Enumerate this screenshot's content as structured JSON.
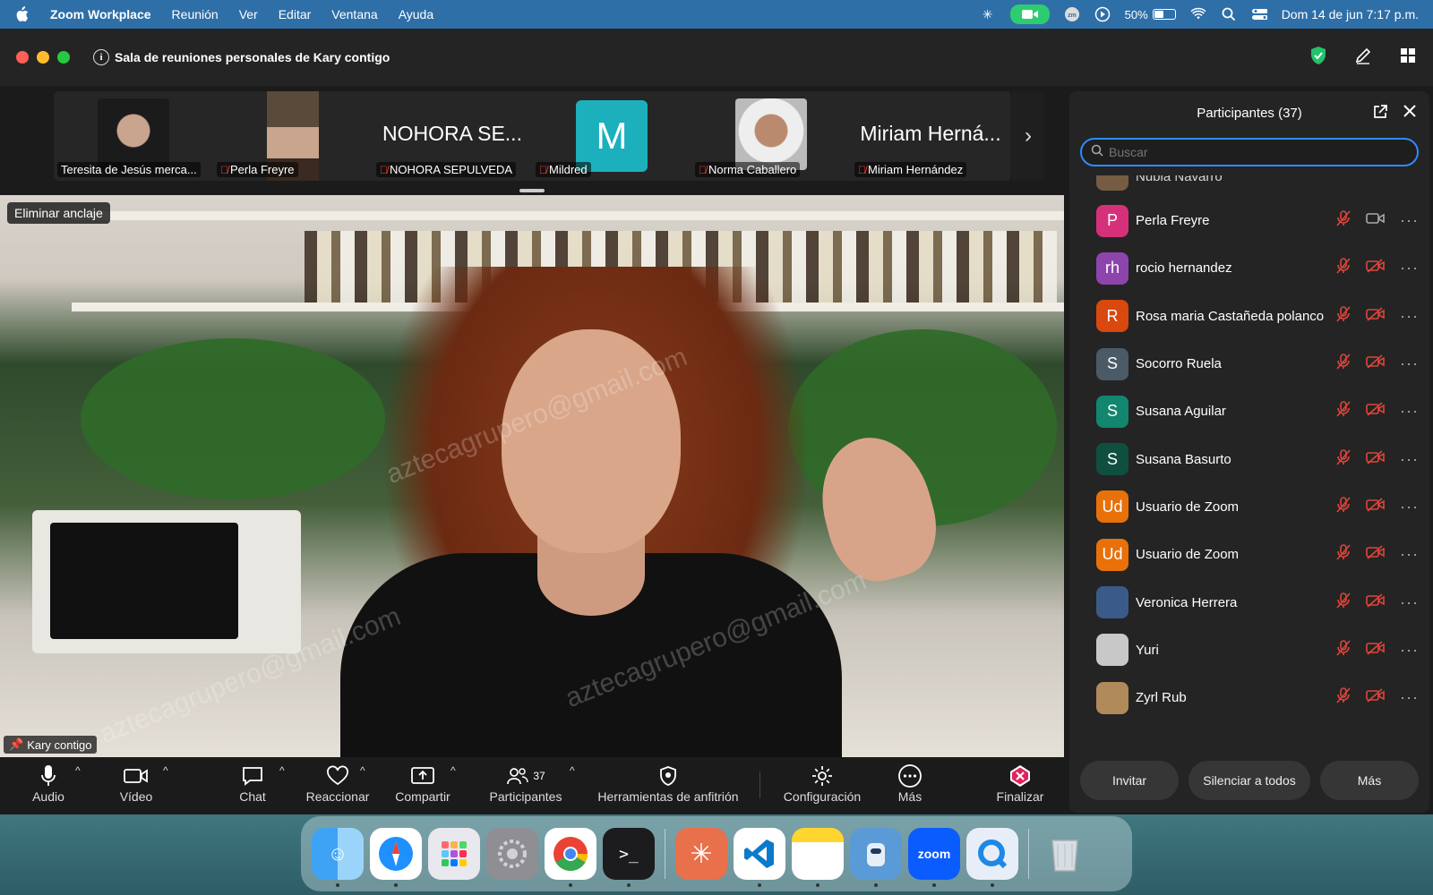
{
  "menubar": {
    "app_name": "Zoom Workplace",
    "menus": [
      "Reunión",
      "Ver",
      "Editar",
      "Ventana",
      "Ayuda"
    ],
    "battery_percent": "50%",
    "battery_level": 0.5,
    "clock": "Dom 14 de jun  7:17 p.m."
  },
  "titlebar": {
    "meeting_title": "Sala de reuniones personales de Kary contigo"
  },
  "thumbnails": [
    {
      "name": "Teresita de Jesús merca...",
      "type": "photo",
      "muted": false
    },
    {
      "name": "Perla Freyre",
      "type": "photo",
      "muted": true
    },
    {
      "name": "NOHORA SEPULVEDA",
      "big_name": "NOHORA SE...",
      "type": "name",
      "muted": true
    },
    {
      "name": "Mildred",
      "letter": "M",
      "type": "letter",
      "muted": true
    },
    {
      "name": "Norma Caballero",
      "type": "photo",
      "muted": true
    },
    {
      "name": "Miriam Hernández",
      "big_name": "Miriam Herná...",
      "type": "name",
      "muted": true
    }
  ],
  "video": {
    "unpin_label": "Eliminar anclaje",
    "speaker_name": "Kary contigo",
    "watermark": "aztecagrupero@gmail.com"
  },
  "panel": {
    "title": "Participantes (37)",
    "search_placeholder": "Buscar",
    "partial_name": "Nubia Navarro",
    "participants": [
      {
        "name": "Perla Freyre",
        "initials": "P",
        "color": "#d6307a",
        "video_off": false
      },
      {
        "name": "rocio hernandez",
        "initials": "rh",
        "color": "#8e44ad",
        "video_off": true
      },
      {
        "name": "Rosa maria Castañeda polanco",
        "initials": "R",
        "color": "#d9480f",
        "video_off": true
      },
      {
        "name": "Socorro Ruela",
        "initials": "S",
        "color": "#4a5a66",
        "video_off": true
      },
      {
        "name": "Susana Aguilar",
        "initials": "S",
        "color": "#12866e",
        "video_off": true
      },
      {
        "name": "Susana Basurto",
        "initials": "S",
        "color": "#0f4f3f",
        "video_off": true
      },
      {
        "name": "Usuario de Zoom",
        "initials": "Ud",
        "color": "#e8710a",
        "video_off": true
      },
      {
        "name": "Usuario de Zoom",
        "initials": "Ud",
        "color": "#e8710a",
        "video_off": true
      },
      {
        "name": "Veronica Herrera",
        "initials": "",
        "color": "#3a5a8a",
        "video_off": true
      },
      {
        "name": "Yuri",
        "initials": "",
        "color": "#c8c8c8",
        "video_off": true
      },
      {
        "name": "Zyrl Rub",
        "initials": "",
        "color": "#b08a5a",
        "video_off": true
      }
    ],
    "buttons": {
      "invite": "Invitar",
      "mute_all": "Silenciar a todos",
      "more": "Más"
    }
  },
  "toolbar": {
    "audio": "Audio",
    "video": "Vídeo",
    "chat": "Chat",
    "react": "Reaccionar",
    "share": "Compartir",
    "participants": "Participantes",
    "participants_count": "37",
    "host_tools": "Herramientas de anfitrión",
    "settings": "Configuración",
    "more": "Más",
    "end": "Finalizar"
  },
  "dock": {
    "zoom_label": "zoom",
    "apps": [
      "finder-icon",
      "safari-icon",
      "launchpad-icon",
      "system-settings-icon",
      "chrome-icon",
      "terminal-icon",
      "claude-icon",
      "vscode-icon",
      "notes-icon",
      "app-icon",
      "zoom-icon",
      "quicktime-icon",
      "trash-icon"
    ]
  },
  "colors": {
    "accent": "#2d8cff",
    "muted_red": "#e0443a",
    "end_red": "#e0245e",
    "zoom_green": "#2ecc71"
  }
}
